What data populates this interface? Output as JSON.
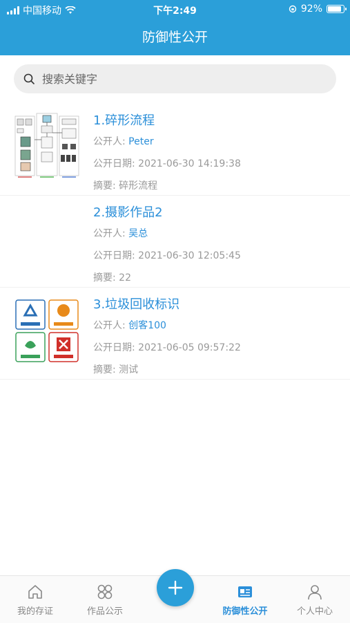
{
  "status_bar": {
    "carrier": "中国移动",
    "time": "下午2:49",
    "battery": "92%",
    "battery_level": 0.92
  },
  "header": {
    "title": "防御性公开"
  },
  "search": {
    "placeholder": "搜索关键字",
    "value": ""
  },
  "labels": {
    "publisher": "公开人: ",
    "date": "公开日期: ",
    "summary": "摘要: "
  },
  "items": [
    {
      "title": "1.碎形流程",
      "publisher": "Peter",
      "date": "2021-06-30 14:19:38",
      "summary": "碎形流程",
      "thumbnail": "flowchart-diagram"
    },
    {
      "title": "2.摄影作品2",
      "publisher": "吴总",
      "date": "2021-06-30 12:05:45",
      "summary": "22",
      "thumbnail": "none"
    },
    {
      "title": "3.垃圾回收标识",
      "publisher": "创客100",
      "date": "2021-06-05 09:57:22",
      "summary": "测试",
      "thumbnail": "recycling-icons"
    }
  ],
  "tabs": [
    {
      "label": "我的存证",
      "icon": "home-icon"
    },
    {
      "label": "作品公示",
      "icon": "grid-icon"
    },
    {
      "label": "防御性公开",
      "icon": "id-card-icon",
      "active": true
    },
    {
      "label": "个人中心",
      "icon": "person-icon"
    }
  ],
  "fab": {
    "icon": "plus-icon"
  },
  "colors": {
    "primary": "#2b9fd9",
    "link": "#2b8fd9",
    "muted": "#999999"
  }
}
